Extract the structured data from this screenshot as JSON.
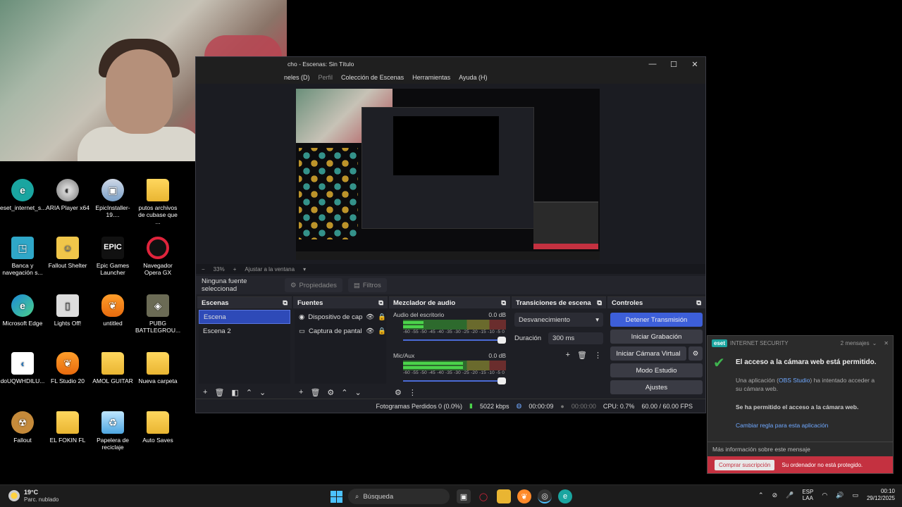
{
  "obs": {
    "title": "cho - Escenas: Sin Título",
    "menu": [
      "neles (D)",
      "Perfil",
      "Colección de Escenas",
      "Herramientas",
      "Ayuda (H)"
    ],
    "zoom": "33%",
    "fit_label": "Ajustar a la ventana",
    "no_source": "Ninguna fuente seleccionad",
    "properties": "Propiedades",
    "filters": "Filtros",
    "scenes": {
      "title": "Escenas",
      "items": [
        "Escena",
        "Escena 2"
      ]
    },
    "sources": {
      "title": "Fuentes",
      "items": [
        "Dispositivo de cap",
        "Captura de pantal"
      ]
    },
    "mixer": {
      "title": "Mezclador de audio",
      "channels": [
        {
          "name": "Audio del escritorio",
          "db": "0.0 dB",
          "level": 0.2,
          "ticks": "-60 -55 -50 -45 -40 -35 -30 -25 -20 -15 -10 -5 0"
        },
        {
          "name": "Mic/Aux",
          "db": "0.0 dB",
          "level": 0.58,
          "ticks": "-60 -55 -50 -45 -40 -35 -30 -25 -20 -15 -10 -5 0"
        }
      ]
    },
    "transitions": {
      "title": "Transiciones de escena",
      "type": "Desvanecimiento",
      "duration_label": "Duración",
      "duration_value": "300 ms"
    },
    "controls": {
      "title": "Controles",
      "stop_stream": "Detener Transmisión",
      "start_record": "Iniciar Grabación",
      "virtual_cam": "Iniciar Cámara Virtual",
      "studio": "Modo Estudio",
      "settings": "Ajustes"
    },
    "status": {
      "dropped": "Fotogramas Perdidos 0 (0.0%)",
      "kbps": "5022 kbps",
      "stream_time": "00:00:09",
      "rec_time": "00:00:00",
      "cpu": "CPU: 0.7%",
      "fps": "60.00 / 60.00 FPS"
    }
  },
  "desktop_icons": [
    {
      "label": "eset_internet_s...",
      "icon": "eset-icon"
    },
    {
      "label": "ARIA Player x64",
      "icon": "aria-icon"
    },
    {
      "label": "EpicInstaller-19....",
      "icon": "installer-icon"
    },
    {
      "label": "putos archivos de cubase que ...",
      "icon": "folder-icon"
    },
    {
      "label": "Banca y navegación s...",
      "icon": "banking-icon"
    },
    {
      "label": "Fallout Shelter",
      "icon": "fallout-shelter-icon"
    },
    {
      "label": "Epic Games Launcher",
      "icon": "epic-games-icon"
    },
    {
      "label": "Navegador Opera GX",
      "icon": "opera-gx-icon"
    },
    {
      "label": "Microsoft Edge",
      "icon": "edge-icon"
    },
    {
      "label": "Lights Off!",
      "icon": "lights-off-icon"
    },
    {
      "label": "untitled",
      "icon": "fl-project-icon"
    },
    {
      "label": "PUBG BATTLEGROU...",
      "icon": "pubg-icon"
    },
    {
      "label": "doUQWHDILU...",
      "icon": "document-icon"
    },
    {
      "label": "FL Studio 20",
      "icon": "fl-studio-icon"
    },
    {
      "label": "AMOL GUITAR",
      "icon": "folder-icon"
    },
    {
      "label": "Nueva carpeta",
      "icon": "folder-icon"
    },
    {
      "label": "Fallout",
      "icon": "fallout-icon"
    },
    {
      "label": "EL FOKIN FL",
      "icon": "folder-icon"
    },
    {
      "label": "Papelera de reciclaje",
      "icon": "recycle-bin-icon"
    },
    {
      "label": "Auto Saves",
      "icon": "folder-icon"
    }
  ],
  "eset": {
    "product": "INTERNET SECURITY",
    "logo": "eset",
    "messages": "2 mensajes",
    "title": "El acceso a la cámara web está permitido.",
    "desc_pre": "Una aplicación (",
    "desc_app": "OBS Studio",
    "desc_post": ") ha intentado acceder a su cámara web.",
    "allowed": "Se ha permitido el acceso a la cámara web.",
    "change_rule": "Cambiar regla para esta aplicación",
    "more_info": "Más información sobre este mensaje",
    "buy": "Comprar suscripción",
    "not_protected": "Su ordenador no está protegido."
  },
  "taskbar": {
    "temp": "19°C",
    "weather": "Parc. nublado",
    "search": "Búsqueda",
    "lang1": "ESP",
    "lang2": "LAA",
    "time": "00:10",
    "date": "29/12/2025"
  }
}
